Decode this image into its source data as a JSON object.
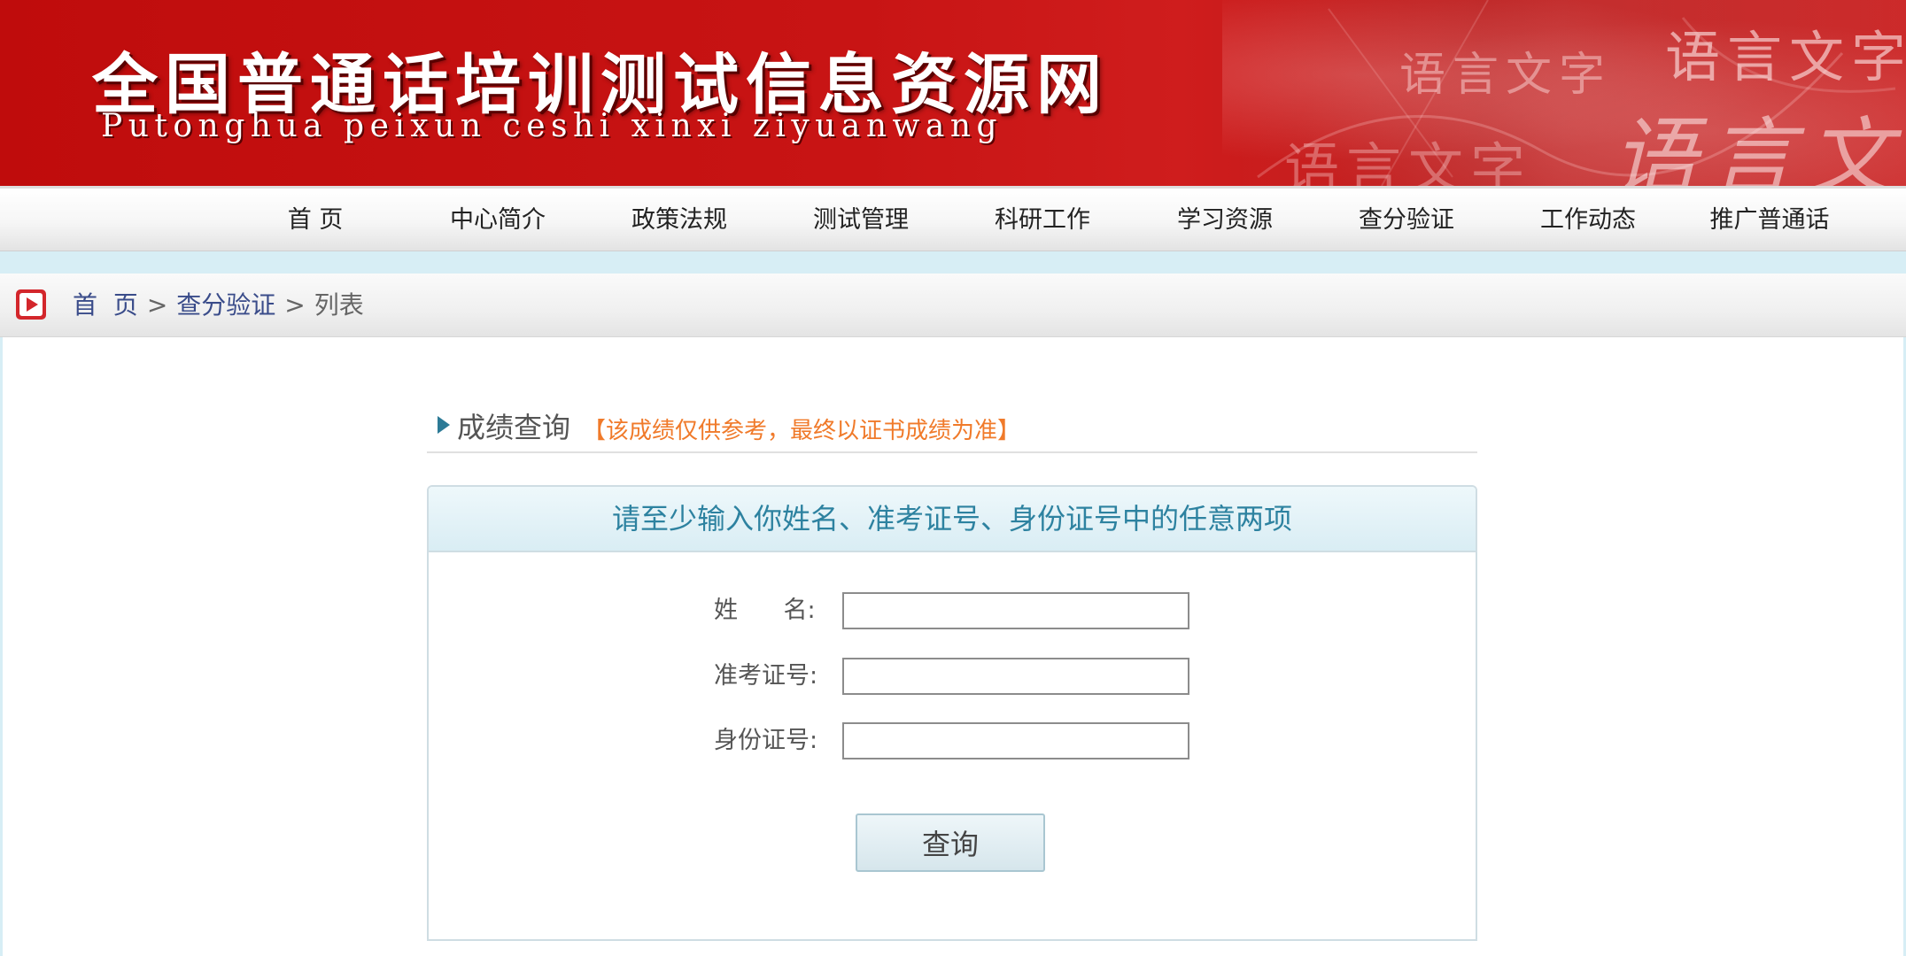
{
  "banner": {
    "title": "全国普通话培训测试信息资源网",
    "pinyin": "Putonghua peixun ceshi xinxi ziyuanwang",
    "deco_text_1": "语言文字",
    "deco_text_2": "语言文字",
    "deco_text_3": "语言文字",
    "deco_text_4": "语言文字"
  },
  "nav": {
    "items": [
      {
        "label": "首  页"
      },
      {
        "label": "中心简介"
      },
      {
        "label": "政策法规"
      },
      {
        "label": "测试管理"
      },
      {
        "label": "科研工作"
      },
      {
        "label": "学习资源"
      },
      {
        "label": "查分验证"
      },
      {
        "label": "工作动态"
      },
      {
        "label": "推广普通话"
      }
    ]
  },
  "breadcrumb": {
    "home": "首  页",
    "sep": ">",
    "section": "查分验证",
    "current": "列表"
  },
  "section": {
    "title": "成绩查询",
    "note": "【该成绩仅供参考，最终以证书成绩为准】"
  },
  "form": {
    "instruction": "请至少输入你姓名、准考证号、身份证号中的任意两项",
    "name_label": "姓      名:",
    "name_value": "",
    "ticket_label": "准考证号:",
    "ticket_value": "",
    "id_label": "身份证号:",
    "id_value": "",
    "submit_label": "查询"
  },
  "colors": {
    "banner_red": "#c81414",
    "nav_text": "#222222",
    "link_blue": "#3a4c8a",
    "note_orange": "#f07a2a",
    "instruction_teal": "#2d82a0",
    "strip_cyan": "#d7eef5"
  }
}
